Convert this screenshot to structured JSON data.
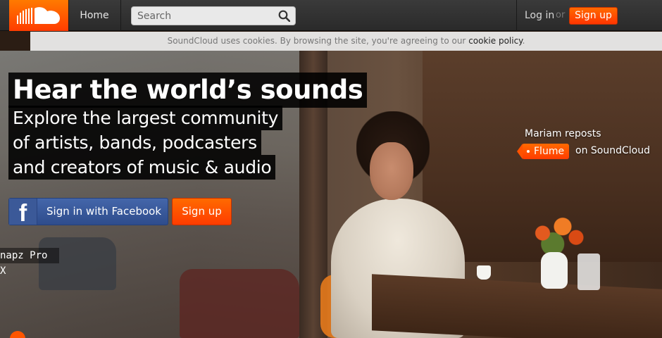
{
  "nav": {
    "logo_name": "soundcloud-logo",
    "home_label": "Home",
    "search_placeholder": "Search",
    "login_label": "Log in",
    "or_label": "or",
    "signup_label": "Sign up"
  },
  "cookie_bar": {
    "message": "SoundCloud uses cookies. By browsing the site, you're agreeing to our ",
    "link_label": "cookie policy",
    "suffix": "."
  },
  "hero": {
    "title": "Hear the world’s sounds",
    "lines": [
      "Explore the largest community",
      "of artists, bands, podcasters",
      "and creators of music & audio"
    ],
    "facebook_button_label": "Sign in with Facebook",
    "facebook_icon": "f",
    "signup_button_label": "Sign up",
    "repost_text": "Mariam reposts",
    "repost_tag": "Flume",
    "repost_suffix": "on SoundCloud"
  },
  "overlay": {
    "snapz_label": "napz Pro X"
  },
  "colors": {
    "brand_orange": "#ff5500",
    "facebook_blue": "#3b5998",
    "topbar_dark": "#333333"
  }
}
